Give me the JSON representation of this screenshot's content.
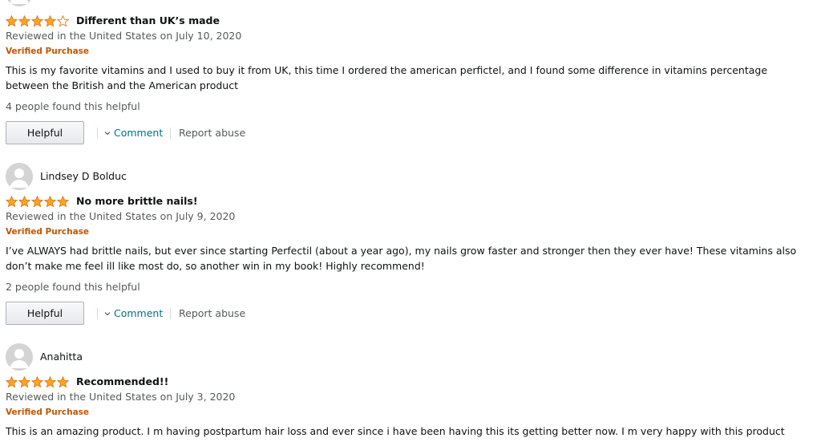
{
  "colors": {
    "star": "#ffa41c",
    "star_empty_stroke": "#de7921",
    "verified": "#c45500",
    "link": "#007185",
    "muted": "#565959"
  },
  "reviews": [
    {
      "author": "",
      "rating": 4,
      "title": "Different than UK’s made",
      "meta": "Reviewed in the United States on July 10, 2020",
      "verified": "Verified Purchase",
      "body": "This is my favorite vitamins and I used to buy it from UK, this time I ordered the american perfictel, and I found some difference in vitamins percentage between the British and the American product",
      "helpful_count": "4 people found this helpful",
      "helpful_label": "Helpful",
      "comment_label": "Comment",
      "report_label": "Report abuse"
    },
    {
      "author": "Lindsey D Bolduc",
      "rating": 5,
      "title": "No more brittle nails!",
      "meta": "Reviewed in the United States on July 9, 2020",
      "verified": "Verified Purchase",
      "body": "I’ve ALWAYS had brittle nails, but ever since starting Perfectil (about a year ago), my nails grow faster and stronger then they ever have! These vitamins also don’t make me feel ill like most do, so another win in my book! Highly recommend!",
      "helpful_count": "2 people found this helpful",
      "helpful_label": "Helpful",
      "comment_label": "Comment",
      "report_label": "Report abuse"
    },
    {
      "author": "Anahitta",
      "rating": 5,
      "title": "Recommended!!",
      "meta": "Reviewed in the United States on July 3, 2020",
      "verified": "Verified Purchase",
      "body": "This is an amazing product. I m having postpartum hair loss and ever since i have been having this its getting better now. I m very happy with this product"
    }
  ]
}
